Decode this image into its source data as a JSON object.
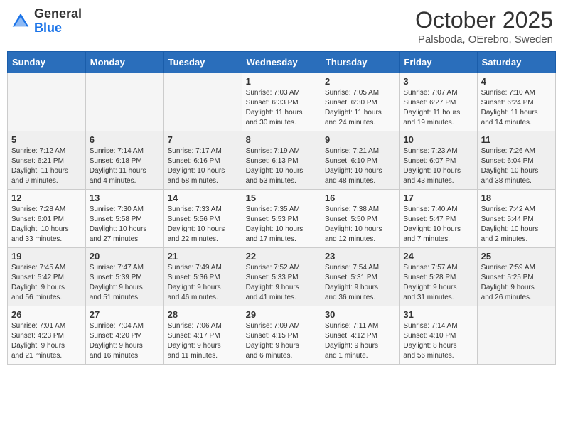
{
  "header": {
    "logo_general": "General",
    "logo_blue": "Blue",
    "title": "October 2025",
    "subtitle": "Palsboda, OErebro, Sweden"
  },
  "weekdays": [
    "Sunday",
    "Monday",
    "Tuesday",
    "Wednesday",
    "Thursday",
    "Friday",
    "Saturday"
  ],
  "weeks": [
    [
      {
        "day": "",
        "info": ""
      },
      {
        "day": "",
        "info": ""
      },
      {
        "day": "",
        "info": ""
      },
      {
        "day": "1",
        "info": "Sunrise: 7:03 AM\nSunset: 6:33 PM\nDaylight: 11 hours\nand 30 minutes."
      },
      {
        "day": "2",
        "info": "Sunrise: 7:05 AM\nSunset: 6:30 PM\nDaylight: 11 hours\nand 24 minutes."
      },
      {
        "day": "3",
        "info": "Sunrise: 7:07 AM\nSunset: 6:27 PM\nDaylight: 11 hours\nand 19 minutes."
      },
      {
        "day": "4",
        "info": "Sunrise: 7:10 AM\nSunset: 6:24 PM\nDaylight: 11 hours\nand 14 minutes."
      }
    ],
    [
      {
        "day": "5",
        "info": "Sunrise: 7:12 AM\nSunset: 6:21 PM\nDaylight: 11 hours\nand 9 minutes."
      },
      {
        "day": "6",
        "info": "Sunrise: 7:14 AM\nSunset: 6:18 PM\nDaylight: 11 hours\nand 4 minutes."
      },
      {
        "day": "7",
        "info": "Sunrise: 7:17 AM\nSunset: 6:16 PM\nDaylight: 10 hours\nand 58 minutes."
      },
      {
        "day": "8",
        "info": "Sunrise: 7:19 AM\nSunset: 6:13 PM\nDaylight: 10 hours\nand 53 minutes."
      },
      {
        "day": "9",
        "info": "Sunrise: 7:21 AM\nSunset: 6:10 PM\nDaylight: 10 hours\nand 48 minutes."
      },
      {
        "day": "10",
        "info": "Sunrise: 7:23 AM\nSunset: 6:07 PM\nDaylight: 10 hours\nand 43 minutes."
      },
      {
        "day": "11",
        "info": "Sunrise: 7:26 AM\nSunset: 6:04 PM\nDaylight: 10 hours\nand 38 minutes."
      }
    ],
    [
      {
        "day": "12",
        "info": "Sunrise: 7:28 AM\nSunset: 6:01 PM\nDaylight: 10 hours\nand 33 minutes."
      },
      {
        "day": "13",
        "info": "Sunrise: 7:30 AM\nSunset: 5:58 PM\nDaylight: 10 hours\nand 27 minutes."
      },
      {
        "day": "14",
        "info": "Sunrise: 7:33 AM\nSunset: 5:56 PM\nDaylight: 10 hours\nand 22 minutes."
      },
      {
        "day": "15",
        "info": "Sunrise: 7:35 AM\nSunset: 5:53 PM\nDaylight: 10 hours\nand 17 minutes."
      },
      {
        "day": "16",
        "info": "Sunrise: 7:38 AM\nSunset: 5:50 PM\nDaylight: 10 hours\nand 12 minutes."
      },
      {
        "day": "17",
        "info": "Sunrise: 7:40 AM\nSunset: 5:47 PM\nDaylight: 10 hours\nand 7 minutes."
      },
      {
        "day": "18",
        "info": "Sunrise: 7:42 AM\nSunset: 5:44 PM\nDaylight: 10 hours\nand 2 minutes."
      }
    ],
    [
      {
        "day": "19",
        "info": "Sunrise: 7:45 AM\nSunset: 5:42 PM\nDaylight: 9 hours\nand 56 minutes."
      },
      {
        "day": "20",
        "info": "Sunrise: 7:47 AM\nSunset: 5:39 PM\nDaylight: 9 hours\nand 51 minutes."
      },
      {
        "day": "21",
        "info": "Sunrise: 7:49 AM\nSunset: 5:36 PM\nDaylight: 9 hours\nand 46 minutes."
      },
      {
        "day": "22",
        "info": "Sunrise: 7:52 AM\nSunset: 5:33 PM\nDaylight: 9 hours\nand 41 minutes."
      },
      {
        "day": "23",
        "info": "Sunrise: 7:54 AM\nSunset: 5:31 PM\nDaylight: 9 hours\nand 36 minutes."
      },
      {
        "day": "24",
        "info": "Sunrise: 7:57 AM\nSunset: 5:28 PM\nDaylight: 9 hours\nand 31 minutes."
      },
      {
        "day": "25",
        "info": "Sunrise: 7:59 AM\nSunset: 5:25 PM\nDaylight: 9 hours\nand 26 minutes."
      }
    ],
    [
      {
        "day": "26",
        "info": "Sunrise: 7:01 AM\nSunset: 4:23 PM\nDaylight: 9 hours\nand 21 minutes."
      },
      {
        "day": "27",
        "info": "Sunrise: 7:04 AM\nSunset: 4:20 PM\nDaylight: 9 hours\nand 16 minutes."
      },
      {
        "day": "28",
        "info": "Sunrise: 7:06 AM\nSunset: 4:17 PM\nDaylight: 9 hours\nand 11 minutes."
      },
      {
        "day": "29",
        "info": "Sunrise: 7:09 AM\nSunset: 4:15 PM\nDaylight: 9 hours\nand 6 minutes."
      },
      {
        "day": "30",
        "info": "Sunrise: 7:11 AM\nSunset: 4:12 PM\nDaylight: 9 hours\nand 1 minute."
      },
      {
        "day": "31",
        "info": "Sunrise: 7:14 AM\nSunset: 4:10 PM\nDaylight: 8 hours\nand 56 minutes."
      },
      {
        "day": "",
        "info": ""
      }
    ]
  ]
}
